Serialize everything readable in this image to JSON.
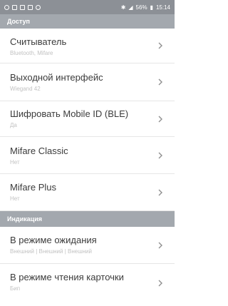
{
  "status_bar": {
    "battery": "56%",
    "time": "15:14"
  },
  "sections": [
    {
      "title": "Доступ",
      "items": [
        {
          "title": "Считыватель",
          "subtitle": "Bluetooth, Mifare"
        },
        {
          "title": "Выходной интерфейс",
          "subtitle": "Wiegand 42"
        },
        {
          "title": "Шифровать Mobile ID (BLE)",
          "subtitle": "Да"
        },
        {
          "title": "Mifare Classic",
          "subtitle": "Нет"
        },
        {
          "title": "Mifare Plus",
          "subtitle": "Нет"
        }
      ]
    },
    {
      "title": "Индикация",
      "items": [
        {
          "title": "В режиме ожидания",
          "subtitle": "Внешний | Внешний | Внешний"
        },
        {
          "title": "В режиме чтения карточки",
          "subtitle": "Бип"
        }
      ]
    }
  ],
  "icons": {
    "chevron": "chevron-right-icon"
  }
}
